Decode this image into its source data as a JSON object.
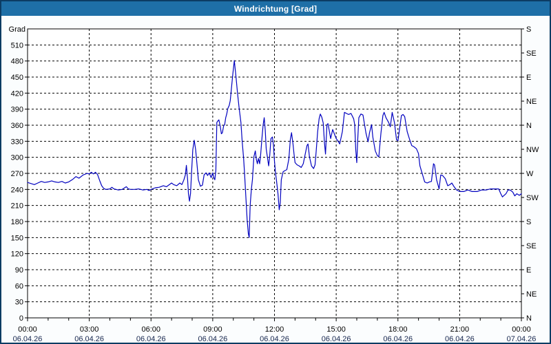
{
  "window": {
    "title": "Windrichtung [Grad]",
    "colors": {
      "titlebar": "#1e6fa7",
      "border": "#0c3c63",
      "background": "#fbfdfe",
      "plot_background": "#ffffff",
      "frame": "#000000",
      "grid": "#000000",
      "tick_text": "#000000",
      "date_text": "#15254d",
      "title_text": "#ffffff",
      "line": "#0000bf"
    }
  },
  "chart_data": {
    "type": "line",
    "title": "Windrichtung [Grad]",
    "grid": {
      "horizontal_step": 30,
      "vertical_step_hours": 3,
      "style": "dashed"
    },
    "x_axis": {
      "range_hours": [
        0,
        24
      ],
      "minor_step_hours": 1,
      "major_ticks": [
        {
          "hour": 0,
          "time": "00:00",
          "date": "06.04.26"
        },
        {
          "hour": 3,
          "time": "03:00",
          "date": "06.04.26"
        },
        {
          "hour": 6,
          "time": "06:00",
          "date": "06.04.26"
        },
        {
          "hour": 9,
          "time": "09:00",
          "date": "06.04.26"
        },
        {
          "hour": 12,
          "time": "12:00",
          "date": "06.04.26"
        },
        {
          "hour": 15,
          "time": "15:00",
          "date": "06.04.26"
        },
        {
          "hour": 18,
          "time": "18:00",
          "date": "06.04.26"
        },
        {
          "hour": 21,
          "time": "21:00",
          "date": "06.04.26"
        },
        {
          "hour": 24,
          "time": "00:00",
          "date": "07.04.26"
        }
      ]
    },
    "y_axis_left": {
      "title": "Grad",
      "min": 0,
      "max": 540,
      "step": 30,
      "tick_labels": [
        "0",
        "30",
        "60",
        "90",
        "120",
        "150",
        "180",
        "210",
        "240",
        "270",
        "300",
        "330",
        "360",
        "390",
        "420",
        "450",
        "480",
        "510"
      ]
    },
    "y_axis_right": {
      "ticks": [
        {
          "value": 0,
          "label": "N"
        },
        {
          "value": 45,
          "label": "NE"
        },
        {
          "value": 90,
          "label": "E"
        },
        {
          "value": 135,
          "label": "SE"
        },
        {
          "value": 180,
          "label": "S"
        },
        {
          "value": 225,
          "label": "SW"
        },
        {
          "value": 270,
          "label": "W"
        },
        {
          "value": 315,
          "label": "NW"
        },
        {
          "value": 360,
          "label": "N"
        },
        {
          "value": 405,
          "label": "NE"
        },
        {
          "value": 450,
          "label": "E"
        },
        {
          "value": 495,
          "label": "SE"
        },
        {
          "value": 540,
          "label": "S"
        }
      ]
    },
    "series": [
      {
        "name": "Windrichtung",
        "color": "#0000bf",
        "points": [
          [
            0,
            253
          ],
          [
            0.17,
            251
          ],
          [
            0.33,
            249
          ],
          [
            0.5,
            252
          ],
          [
            0.67,
            255
          ],
          [
            0.83,
            253
          ],
          [
            1,
            254
          ],
          [
            1.17,
            256
          ],
          [
            1.33,
            254
          ],
          [
            1.5,
            253
          ],
          [
            1.67,
            255
          ],
          [
            1.83,
            252
          ],
          [
            2,
            254
          ],
          [
            2.2,
            259
          ],
          [
            2.35,
            264
          ],
          [
            2.5,
            261
          ],
          [
            2.7,
            267
          ],
          [
            2.9,
            270
          ],
          [
            3,
            269
          ],
          [
            3.1,
            272
          ],
          [
            3.2,
            269
          ],
          [
            3.3,
            272
          ],
          [
            3.4,
            268
          ],
          [
            3.5,
            257
          ],
          [
            3.6,
            247
          ],
          [
            3.7,
            242
          ],
          [
            3.8,
            240
          ],
          [
            4,
            241
          ],
          [
            4.1,
            244
          ],
          [
            4.2,
            241
          ],
          [
            4.4,
            239
          ],
          [
            4.6,
            240
          ],
          [
            4.8,
            245
          ],
          [
            4.9,
            241
          ],
          [
            5,
            240
          ],
          [
            5.2,
            240
          ],
          [
            5.4,
            241
          ],
          [
            5.6,
            239
          ],
          [
            5.8,
            240
          ],
          [
            5.9,
            238
          ],
          [
            6,
            240
          ],
          [
            6.2,
            243
          ],
          [
            6.4,
            244
          ],
          [
            6.6,
            247
          ],
          [
            6.75,
            245
          ],
          [
            7,
            252
          ],
          [
            7.1,
            249
          ],
          [
            7.25,
            247
          ],
          [
            7.4,
            252
          ],
          [
            7.5,
            249
          ],
          [
            7.6,
            258
          ],
          [
            7.67,
            267
          ],
          [
            7.72,
            285
          ],
          [
            7.78,
            258
          ],
          [
            7.82,
            232
          ],
          [
            7.87,
            218
          ],
          [
            7.92,
            232
          ],
          [
            7.97,
            271
          ],
          [
            8.03,
            314
          ],
          [
            8.1,
            332
          ],
          [
            8.17,
            314
          ],
          [
            8.25,
            280
          ],
          [
            8.3,
            258
          ],
          [
            8.4,
            246
          ],
          [
            8.5,
            248
          ],
          [
            8.58,
            267
          ],
          [
            8.67,
            271
          ],
          [
            8.75,
            266
          ],
          [
            8.83,
            271
          ],
          [
            8.92,
            262
          ],
          [
            9,
            271
          ],
          [
            9.05,
            262
          ],
          [
            9.1,
            258
          ],
          [
            9.15,
            275
          ],
          [
            9.2,
            365
          ],
          [
            9.25,
            368
          ],
          [
            9.3,
            370
          ],
          [
            9.37,
            357
          ],
          [
            9.42,
            344
          ],
          [
            9.47,
            346
          ],
          [
            9.53,
            359
          ],
          [
            9.58,
            361
          ],
          [
            9.63,
            374
          ],
          [
            9.68,
            381
          ],
          [
            9.73,
            391
          ],
          [
            9.8,
            397
          ],
          [
            9.85,
            406
          ],
          [
            9.9,
            426
          ],
          [
            9.97,
            454
          ],
          [
            10.05,
            481
          ],
          [
            10.13,
            451
          ],
          [
            10.2,
            422
          ],
          [
            10.28,
            393
          ],
          [
            10.37,
            365
          ],
          [
            10.43,
            330
          ],
          [
            10.5,
            298
          ],
          [
            10.55,
            267
          ],
          [
            10.6,
            232
          ],
          [
            10.67,
            184
          ],
          [
            10.73,
            157
          ],
          [
            10.77,
            150
          ],
          [
            10.82,
            210
          ],
          [
            10.88,
            241
          ],
          [
            10.93,
            258
          ],
          [
            11,
            301
          ],
          [
            11.07,
            312
          ],
          [
            11.12,
            296
          ],
          [
            11.17,
            288
          ],
          [
            11.22,
            298
          ],
          [
            11.28,
            288
          ],
          [
            11.33,
            306
          ],
          [
            11.4,
            340
          ],
          [
            11.45,
            361
          ],
          [
            11.5,
            374
          ],
          [
            11.55,
            351
          ],
          [
            11.6,
            316
          ],
          [
            11.67,
            297
          ],
          [
            11.72,
            284
          ],
          [
            11.77,
            303
          ],
          [
            11.83,
            335
          ],
          [
            11.9,
            338
          ],
          [
            11.95,
            323
          ],
          [
            12,
            293
          ],
          [
            12.05,
            271
          ],
          [
            12.1,
            256
          ],
          [
            12.17,
            232
          ],
          [
            12.23,
            202
          ],
          [
            12.28,
            215
          ],
          [
            12.33,
            258
          ],
          [
            12.42,
            273
          ],
          [
            12.5,
            275
          ],
          [
            12.6,
            277
          ],
          [
            12.7,
            297
          ],
          [
            12.77,
            333
          ],
          [
            12.83,
            346
          ],
          [
            12.9,
            325
          ],
          [
            12.95,
            306
          ],
          [
            13,
            290
          ],
          [
            13.1,
            286
          ],
          [
            13.2,
            284
          ],
          [
            13.3,
            281
          ],
          [
            13.4,
            288
          ],
          [
            13.5,
            307
          ],
          [
            13.58,
            322
          ],
          [
            13.63,
            325
          ],
          [
            13.7,
            301
          ],
          [
            13.8,
            284
          ],
          [
            13.9,
            279
          ],
          [
            13.97,
            286
          ],
          [
            14.03,
            312
          ],
          [
            14.1,
            348
          ],
          [
            14.17,
            372
          ],
          [
            14.23,
            381
          ],
          [
            14.3,
            375
          ],
          [
            14.37,
            364
          ],
          [
            14.43,
            327
          ],
          [
            14.48,
            306
          ],
          [
            14.55,
            361
          ],
          [
            14.6,
            363
          ],
          [
            14.67,
            348
          ],
          [
            14.73,
            335
          ],
          [
            14.83,
            352
          ],
          [
            14.93,
            342
          ],
          [
            15,
            335
          ],
          [
            15.08,
            331
          ],
          [
            15.17,
            325
          ],
          [
            15.3,
            348
          ],
          [
            15.4,
            384
          ],
          [
            15.5,
            382
          ],
          [
            15.6,
            380
          ],
          [
            15.72,
            382
          ],
          [
            15.85,
            372
          ],
          [
            15.9,
            361
          ],
          [
            15.95,
            314
          ],
          [
            16,
            290
          ],
          [
            16.05,
            336
          ],
          [
            16.1,
            374
          ],
          [
            16.2,
            381
          ],
          [
            16.3,
            379
          ],
          [
            16.45,
            345
          ],
          [
            16.55,
            329
          ],
          [
            16.62,
            346
          ],
          [
            16.72,
            361
          ],
          [
            16.78,
            338
          ],
          [
            16.9,
            312
          ],
          [
            17,
            303
          ],
          [
            17.07,
            301
          ],
          [
            17.17,
            344
          ],
          [
            17.27,
            378
          ],
          [
            17.33,
            384
          ],
          [
            17.42,
            374
          ],
          [
            17.55,
            365
          ],
          [
            17.63,
            357
          ],
          [
            17.72,
            384
          ],
          [
            17.83,
            365
          ],
          [
            17.93,
            333
          ],
          [
            18,
            331
          ],
          [
            18.07,
            350
          ],
          [
            18.17,
            378
          ],
          [
            18.25,
            380
          ],
          [
            18.33,
            376
          ],
          [
            18.45,
            348
          ],
          [
            18.57,
            333
          ],
          [
            18.67,
            322
          ],
          [
            18.77,
            320
          ],
          [
            18.9,
            316
          ],
          [
            19,
            307
          ],
          [
            19.07,
            284
          ],
          [
            19.17,
            271
          ],
          [
            19.3,
            254
          ],
          [
            19.42,
            252
          ],
          [
            19.53,
            254
          ],
          [
            19.63,
            255
          ],
          [
            19.73,
            288
          ],
          [
            19.78,
            286
          ],
          [
            19.88,
            258
          ],
          [
            20,
            241
          ],
          [
            20.08,
            267
          ],
          [
            20.17,
            266
          ],
          [
            20.3,
            260
          ],
          [
            20.42,
            247
          ],
          [
            20.53,
            249
          ],
          [
            20.62,
            252
          ],
          [
            20.73,
            245
          ],
          [
            20.85,
            239
          ],
          [
            21,
            236
          ],
          [
            21.2,
            236
          ],
          [
            21.4,
            239
          ],
          [
            21.6,
            236
          ],
          [
            21.85,
            236
          ],
          [
            22.07,
            239
          ],
          [
            22.3,
            239
          ],
          [
            22.5,
            241
          ],
          [
            22.75,
            241
          ],
          [
            22.9,
            241
          ],
          [
            23,
            232
          ],
          [
            23.08,
            226
          ],
          [
            23.25,
            232
          ],
          [
            23.35,
            239
          ],
          [
            23.45,
            239
          ],
          [
            23.58,
            235
          ],
          [
            23.68,
            228
          ],
          [
            23.78,
            232
          ],
          [
            23.9,
            229
          ],
          [
            24,
            232
          ]
        ]
      }
    ]
  }
}
